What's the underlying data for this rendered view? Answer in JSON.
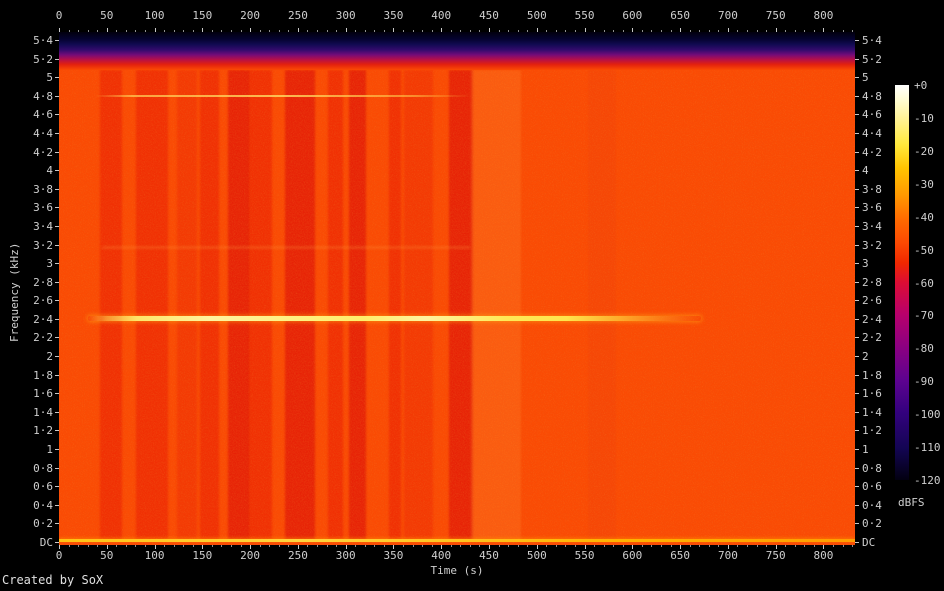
{
  "window": {
    "footer_credit": "Created by SoX"
  },
  "chart_data": {
    "type": "heatmap",
    "subtype": "audio-spectrogram",
    "title": "",
    "xlabel": "Time (s)",
    "ylabel": "Frequency (kHz)",
    "colorbar_label": "dBFS",
    "x_range_s": [
      0,
      833
    ],
    "x_major_ticks_s": [
      0,
      50,
      100,
      150,
      200,
      250,
      300,
      350,
      400,
      450,
      500,
      550,
      600,
      650,
      700,
      750,
      800
    ],
    "x_minor_step_s": 10,
    "y_range_khz": [
      0,
      5.49
    ],
    "y_ticks": [
      {
        "label": "5·4",
        "khz": 5.4
      },
      {
        "label": "5·2",
        "khz": 5.2
      },
      {
        "label": "5",
        "khz": 5.0
      },
      {
        "label": "4·8",
        "khz": 4.8
      },
      {
        "label": "4·6",
        "khz": 4.6
      },
      {
        "label": "4·4",
        "khz": 4.4
      },
      {
        "label": "4·2",
        "khz": 4.2
      },
      {
        "label": "4",
        "khz": 4.0
      },
      {
        "label": "3·8",
        "khz": 3.8
      },
      {
        "label": "3·6",
        "khz": 3.6
      },
      {
        "label": "3·4",
        "khz": 3.4
      },
      {
        "label": "3·2",
        "khz": 3.2
      },
      {
        "label": "3",
        "khz": 3.0
      },
      {
        "label": "2·8",
        "khz": 2.8
      },
      {
        "label": "2·6",
        "khz": 2.6
      },
      {
        "label": "2·4",
        "khz": 2.4
      },
      {
        "label": "2·2",
        "khz": 2.2
      },
      {
        "label": "2",
        "khz": 2.0
      },
      {
        "label": "1·8",
        "khz": 1.8
      },
      {
        "label": "1·6",
        "khz": 1.6
      },
      {
        "label": "1·4",
        "khz": 1.4
      },
      {
        "label": "1·2",
        "khz": 1.2
      },
      {
        "label": "1",
        "khz": 1.0
      },
      {
        "label": "0·8",
        "khz": 0.8
      },
      {
        "label": "0·6",
        "khz": 0.6
      },
      {
        "label": "0·4",
        "khz": 0.4
      },
      {
        "label": "0·2",
        "khz": 0.2
      },
      {
        "label": "DC",
        "khz": 0.0
      }
    ],
    "colorbar": {
      "ticks": [
        "+0",
        "-10",
        "-20",
        "-30",
        "-40",
        "-50",
        "-60",
        "-70",
        "-80",
        "-90",
        "-100",
        "-110",
        "-120"
      ],
      "range_dbfs": [
        0,
        -120
      ],
      "palette_top_to_bottom": [
        "#ffffff",
        "#fff18f",
        "#ffe93d",
        "#ffc400",
        "#ff9800",
        "#ff6a00",
        "#fc4902",
        "#f02800",
        "#dc0d34",
        "#b8006b",
        "#8d0080",
        "#5c0290",
        "#33017e",
        "#130553",
        "#020010"
      ]
    },
    "background_level_color": "#fb4a03",
    "features": {
      "top_band": {
        "freq_khz_from": 5.4,
        "freq_khz_to": 5.49,
        "desc": "very low energy band near Nyquist, fading black-blue-purple-red into orange"
      },
      "horizontal_lines": [
        {
          "freq_khz": 4.8,
          "t_start_s": 38,
          "t_end_s": 430,
          "intensity": "faint"
        },
        {
          "freq_khz": 3.17,
          "t_start_s": 45,
          "t_end_s": 430,
          "intensity": "very-faint"
        },
        {
          "freq_khz": 2.4,
          "t_start_s": 30,
          "t_end_s": 672,
          "intensity": "bright"
        },
        {
          "freq_khz": 0.02,
          "t_start_s": 0,
          "t_end_s": 833,
          "intensity": "bright-edge"
        }
      ],
      "vertical_bands": [
        {
          "t0": 43,
          "t1": 66,
          "level": "dark"
        },
        {
          "t0": 81,
          "t1": 114,
          "level": "dark"
        },
        {
          "t0": 123,
          "t1": 144,
          "level": "medium"
        },
        {
          "t0": 148,
          "t1": 167,
          "level": "dark"
        },
        {
          "t0": 177,
          "t1": 200,
          "level": "darker"
        },
        {
          "t0": 200,
          "t1": 223,
          "level": "dark"
        },
        {
          "t0": 237,
          "t1": 268,
          "level": "darker"
        },
        {
          "t0": 282,
          "t1": 297,
          "level": "dark"
        },
        {
          "t0": 304,
          "t1": 321,
          "level": "darker"
        },
        {
          "t0": 345,
          "t1": 358,
          "level": "dark"
        },
        {
          "t0": 361,
          "t1": 391,
          "level": "medium"
        },
        {
          "t0": 408,
          "t1": 433,
          "level": "darker"
        },
        {
          "t0": 431,
          "t1": 483,
          "level": "light"
        },
        {
          "t0": 554,
          "t1": 583,
          "level": "faint"
        }
      ]
    }
  }
}
